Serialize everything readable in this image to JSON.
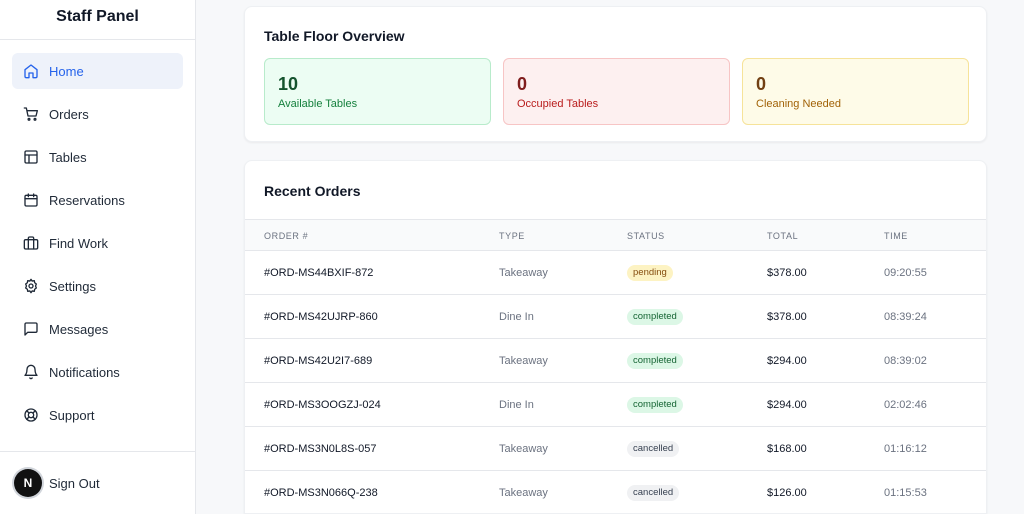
{
  "sidebar": {
    "brand": "Staff Panel",
    "items": [
      {
        "label": "Home",
        "icon": "home-icon",
        "active": true
      },
      {
        "label": "Orders",
        "icon": "cart-icon"
      },
      {
        "label": "Tables",
        "icon": "table-icon"
      },
      {
        "label": "Reservations",
        "icon": "calendar-icon"
      },
      {
        "label": "Find Work",
        "icon": "briefcase-icon"
      },
      {
        "label": "Settings",
        "icon": "gear-icon"
      },
      {
        "label": "Messages",
        "icon": "message-icon"
      },
      {
        "label": "Notifications",
        "icon": "bell-icon"
      },
      {
        "label": "Support",
        "icon": "lifebuoy-icon"
      }
    ],
    "avatar_initial": "N",
    "signout_label": "Sign Out"
  },
  "overview": {
    "title": "Table Floor Overview",
    "stats": [
      {
        "value": "10",
        "label": "Available Tables",
        "color": "#15803d"
      },
      {
        "value": "0",
        "label": "Occupied Tables",
        "color": "#b91c1c"
      },
      {
        "value": "0",
        "label": "Cleaning Needed",
        "color": "#a16207"
      }
    ]
  },
  "orders": {
    "title": "Recent Orders",
    "columns": [
      "Order #",
      "Type",
      "Status",
      "Total",
      "Time"
    ],
    "rows": [
      {
        "order": "#ORD-MS44BXIF-872",
        "type": "Takeaway",
        "status": "pending",
        "total": "$378.00",
        "time": "09:20:55"
      },
      {
        "order": "#ORD-MS42UJRP-860",
        "type": "Dine In",
        "status": "completed",
        "total": "$378.00",
        "time": "08:39:24"
      },
      {
        "order": "#ORD-MS42U2I7-689",
        "type": "Takeaway",
        "status": "completed",
        "total": "$294.00",
        "time": "08:39:02"
      },
      {
        "order": "#ORD-MS3OOGZJ-024",
        "type": "Dine In",
        "status": "completed",
        "total": "$294.00",
        "time": "02:02:46"
      },
      {
        "order": "#ORD-MS3N0L8S-057",
        "type": "Takeaway",
        "status": "cancelled",
        "total": "$168.00",
        "time": "01:16:12"
      },
      {
        "order": "#ORD-MS3N066Q-238",
        "type": "Takeaway",
        "status": "cancelled",
        "total": "$126.00",
        "time": "01:15:53"
      }
    ]
  }
}
